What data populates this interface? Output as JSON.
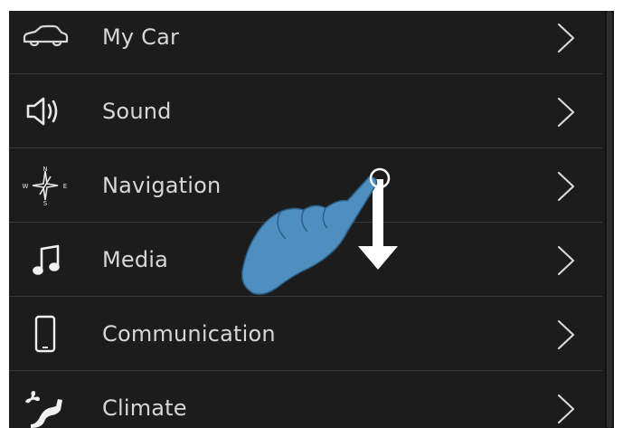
{
  "menu": {
    "items": [
      {
        "label": "My Car",
        "icon": "car-icon"
      },
      {
        "label": "Sound",
        "icon": "speaker-icon"
      },
      {
        "label": "Navigation",
        "icon": "compass-icon"
      },
      {
        "label": "Media",
        "icon": "music-note-icon"
      },
      {
        "label": "Communication",
        "icon": "phone-icon"
      },
      {
        "label": "Climate",
        "icon": "climate-icon"
      }
    ],
    "compass_letters": {
      "n": "N",
      "e": "E",
      "s": "S",
      "w": "W"
    }
  },
  "gesture": {
    "type": "swipe-down",
    "hand_color": "#4f8fc0",
    "arrow_color": "#ffffff"
  },
  "colors": {
    "background": "#1c1c1c",
    "divider": "#3a3a3a",
    "text": "#d7d7d7"
  }
}
